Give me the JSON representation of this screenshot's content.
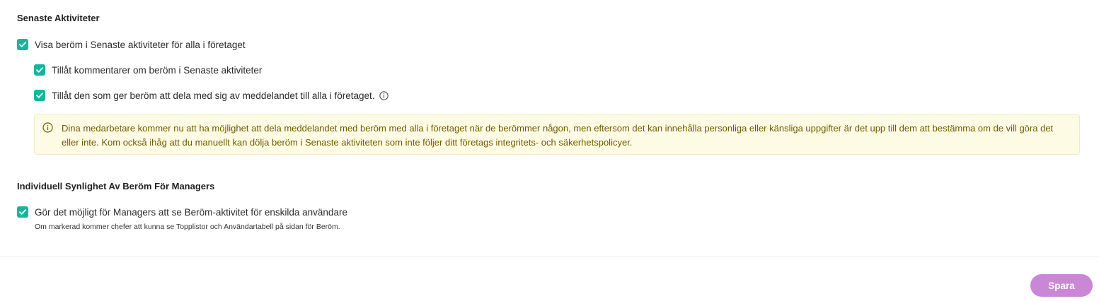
{
  "section1": {
    "title": "Senaste Aktiviteter",
    "show_praise_label": "Visa beröm i Senaste aktiviteter för alla i företaget",
    "allow_comments_label": "Tillåt kommentarer om beröm i Senaste aktiviteter",
    "allow_share_label": "Tillåt den som ger beröm att dela med sig av meddelandet till alla i företaget.",
    "alert_text": "Dina medarbetare kommer nu att ha möjlighet att dela meddelandet med beröm med alla i företaget när de berömmer någon, men eftersom det kan innehålla personliga eller känsliga uppgifter är det upp till dem att bestämma om de vill göra det eller inte. Kom också ihåg att du manuellt kan dölja beröm i Senaste aktiviteten som inte följer ditt företags integritets- och säkerhetspolicyer."
  },
  "section2": {
    "title": "Individuell Synlighet Av Beröm För Managers",
    "manager_visibility_label": "Gör det möjligt för Managers att se Beröm-aktivitet för enskilda användare",
    "manager_visibility_hint": "Om markerad kommer chefer att kunna se Topplistor och Användartabell på sidan för Beröm."
  },
  "checkboxes": {
    "show_praise": true,
    "allow_comments": true,
    "allow_share": true,
    "manager_visibility": true
  },
  "footer": {
    "save_label": "Spara"
  },
  "colors": {
    "checkbox": "#16b69c",
    "alert_background": "#fdfbe3",
    "alert_text": "#6f5a00",
    "save_button": "#c987d6"
  },
  "icons": {
    "check": "check-icon",
    "info": "info-icon"
  }
}
